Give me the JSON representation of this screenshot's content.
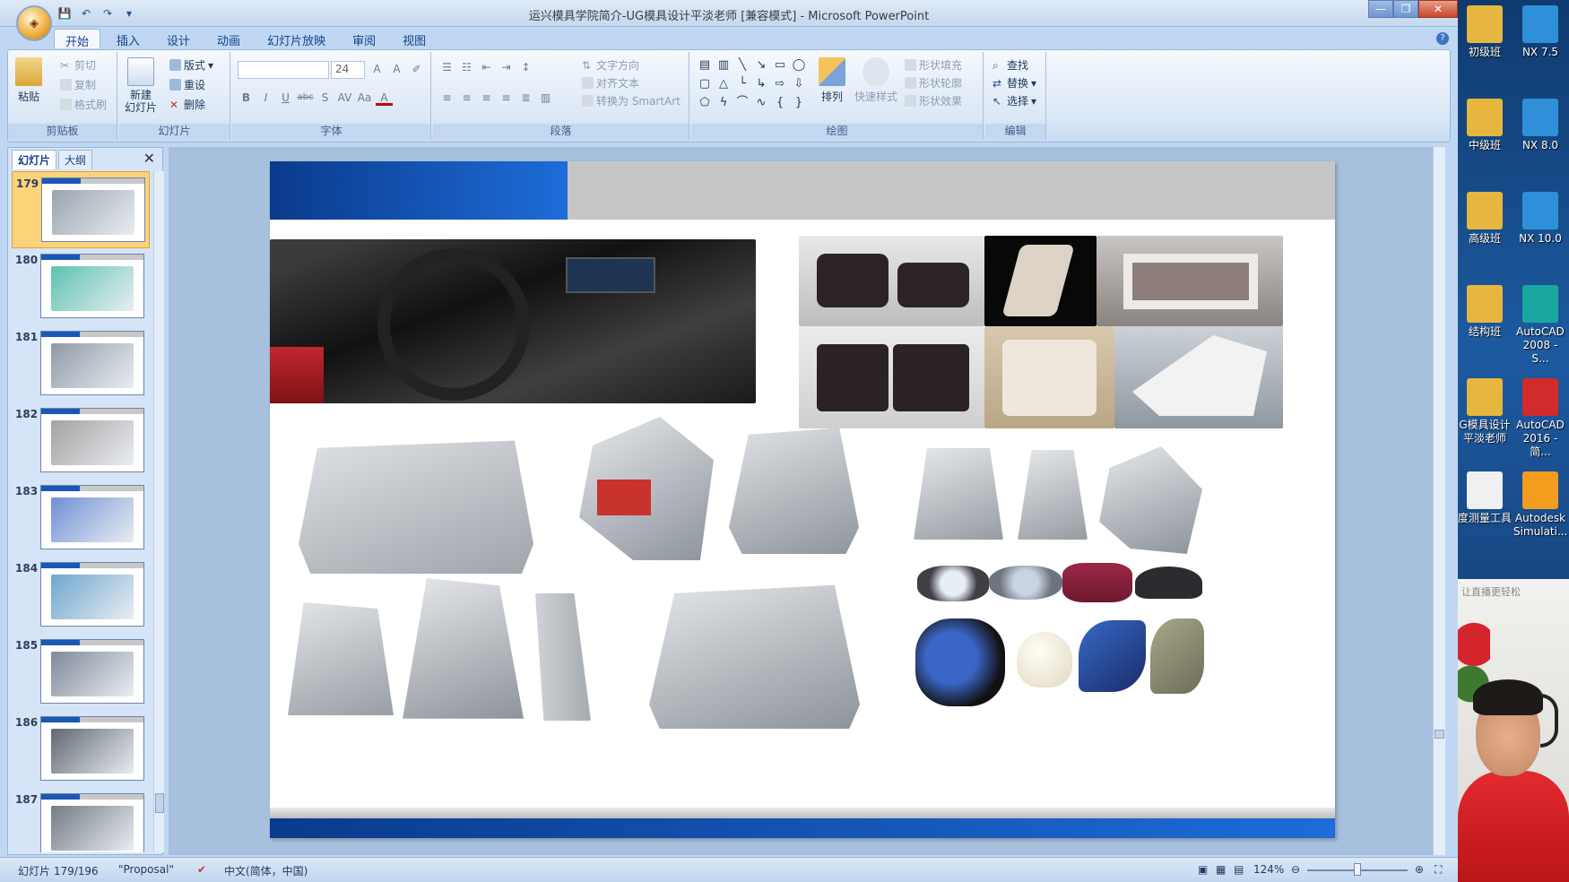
{
  "window": {
    "title": "运兴模具学院简介-UG模具设计平淡老师 [兼容模式] - Microsoft PowerPoint",
    "controls": {
      "minimize": "—",
      "restore": "❐",
      "close": "✕"
    },
    "office_button": "◈"
  },
  "qat": {
    "save": "💾",
    "undo": "↶",
    "redo": "↷",
    "customize": "▾"
  },
  "tabs": [
    "开始",
    "插入",
    "设计",
    "动画",
    "幻灯片放映",
    "审阅",
    "视图"
  ],
  "ribbon": {
    "clipboard": {
      "label": "剪贴板",
      "paste": "粘贴",
      "cut": "剪切",
      "copy": "复制",
      "format_painter": "格式刷"
    },
    "slides": {
      "label": "幻灯片",
      "new_slide": "新建\n幻灯片",
      "layout": "版式",
      "reset": "重设",
      "delete": "删除"
    },
    "font": {
      "label": "字体",
      "font_name": "",
      "font_size": "24",
      "grow": "A",
      "shrink": "A",
      "bold": "B",
      "italic": "I",
      "underline": "U",
      "strike": "abc",
      "shadow": "S",
      "spacing": "AV",
      "case": "Aa",
      "color": "A"
    },
    "paragraph": {
      "label": "段落",
      "text_direction": "文字方向",
      "align_text": "对齐文本",
      "smartart": "转换为 SmartArt"
    },
    "drawing": {
      "label": "绘图",
      "arrange": "排列",
      "quick_styles": "快速样式",
      "shape_fill": "形状填充",
      "shape_outline": "形状轮廓",
      "shape_effects": "形状效果"
    },
    "editing": {
      "label": "编辑",
      "find": "查找",
      "replace": "替换",
      "select": "选择"
    }
  },
  "panel": {
    "tabs": [
      "幻灯片",
      "大纲"
    ],
    "close": "✕",
    "slides": [
      {
        "num": "179",
        "selected": true
      },
      {
        "num": "180",
        "selected": false
      },
      {
        "num": "181",
        "selected": false
      },
      {
        "num": "182",
        "selected": false
      },
      {
        "num": "183",
        "selected": false
      },
      {
        "num": "184",
        "selected": false
      },
      {
        "num": "185",
        "selected": false
      },
      {
        "num": "186",
        "selected": false
      },
      {
        "num": "187",
        "selected": false
      }
    ]
  },
  "status": {
    "slide_counter": "幻灯片 179/196",
    "theme": "\"Proposal\"",
    "language": "中文(简体，中国)",
    "zoom": "124%",
    "zoom_level": 0.5
  },
  "desktop": {
    "icons": [
      {
        "label": "初级班",
        "color": "#e6b63f"
      },
      {
        "label": "NX 7.5",
        "color": "#2f8fd8"
      },
      {
        "label": "中级班",
        "color": "#e6b63f"
      },
      {
        "label": "NX 8.0",
        "color": "#2f8fd8"
      },
      {
        "label": "高级班",
        "color": "#e6b63f"
      },
      {
        "label": "NX 10.0",
        "color": "#2f8fd8"
      },
      {
        "label": "结构班",
        "color": "#e6b63f"
      },
      {
        "label": "AutoCAD 2008 - S...",
        "color": "#1aa7a0"
      },
      {
        "label": "G模具设计 平淡老师",
        "color": "#e6b63f"
      },
      {
        "label": "AutoCAD 2016 - 简...",
        "color": "#d22b2b"
      },
      {
        "label": "度测量工具",
        "color": "#f0f0f0"
      },
      {
        "label": "Autodesk Simulati...",
        "color": "#f39c1e"
      }
    ],
    "webcam_hint": "让直播更轻松"
  }
}
